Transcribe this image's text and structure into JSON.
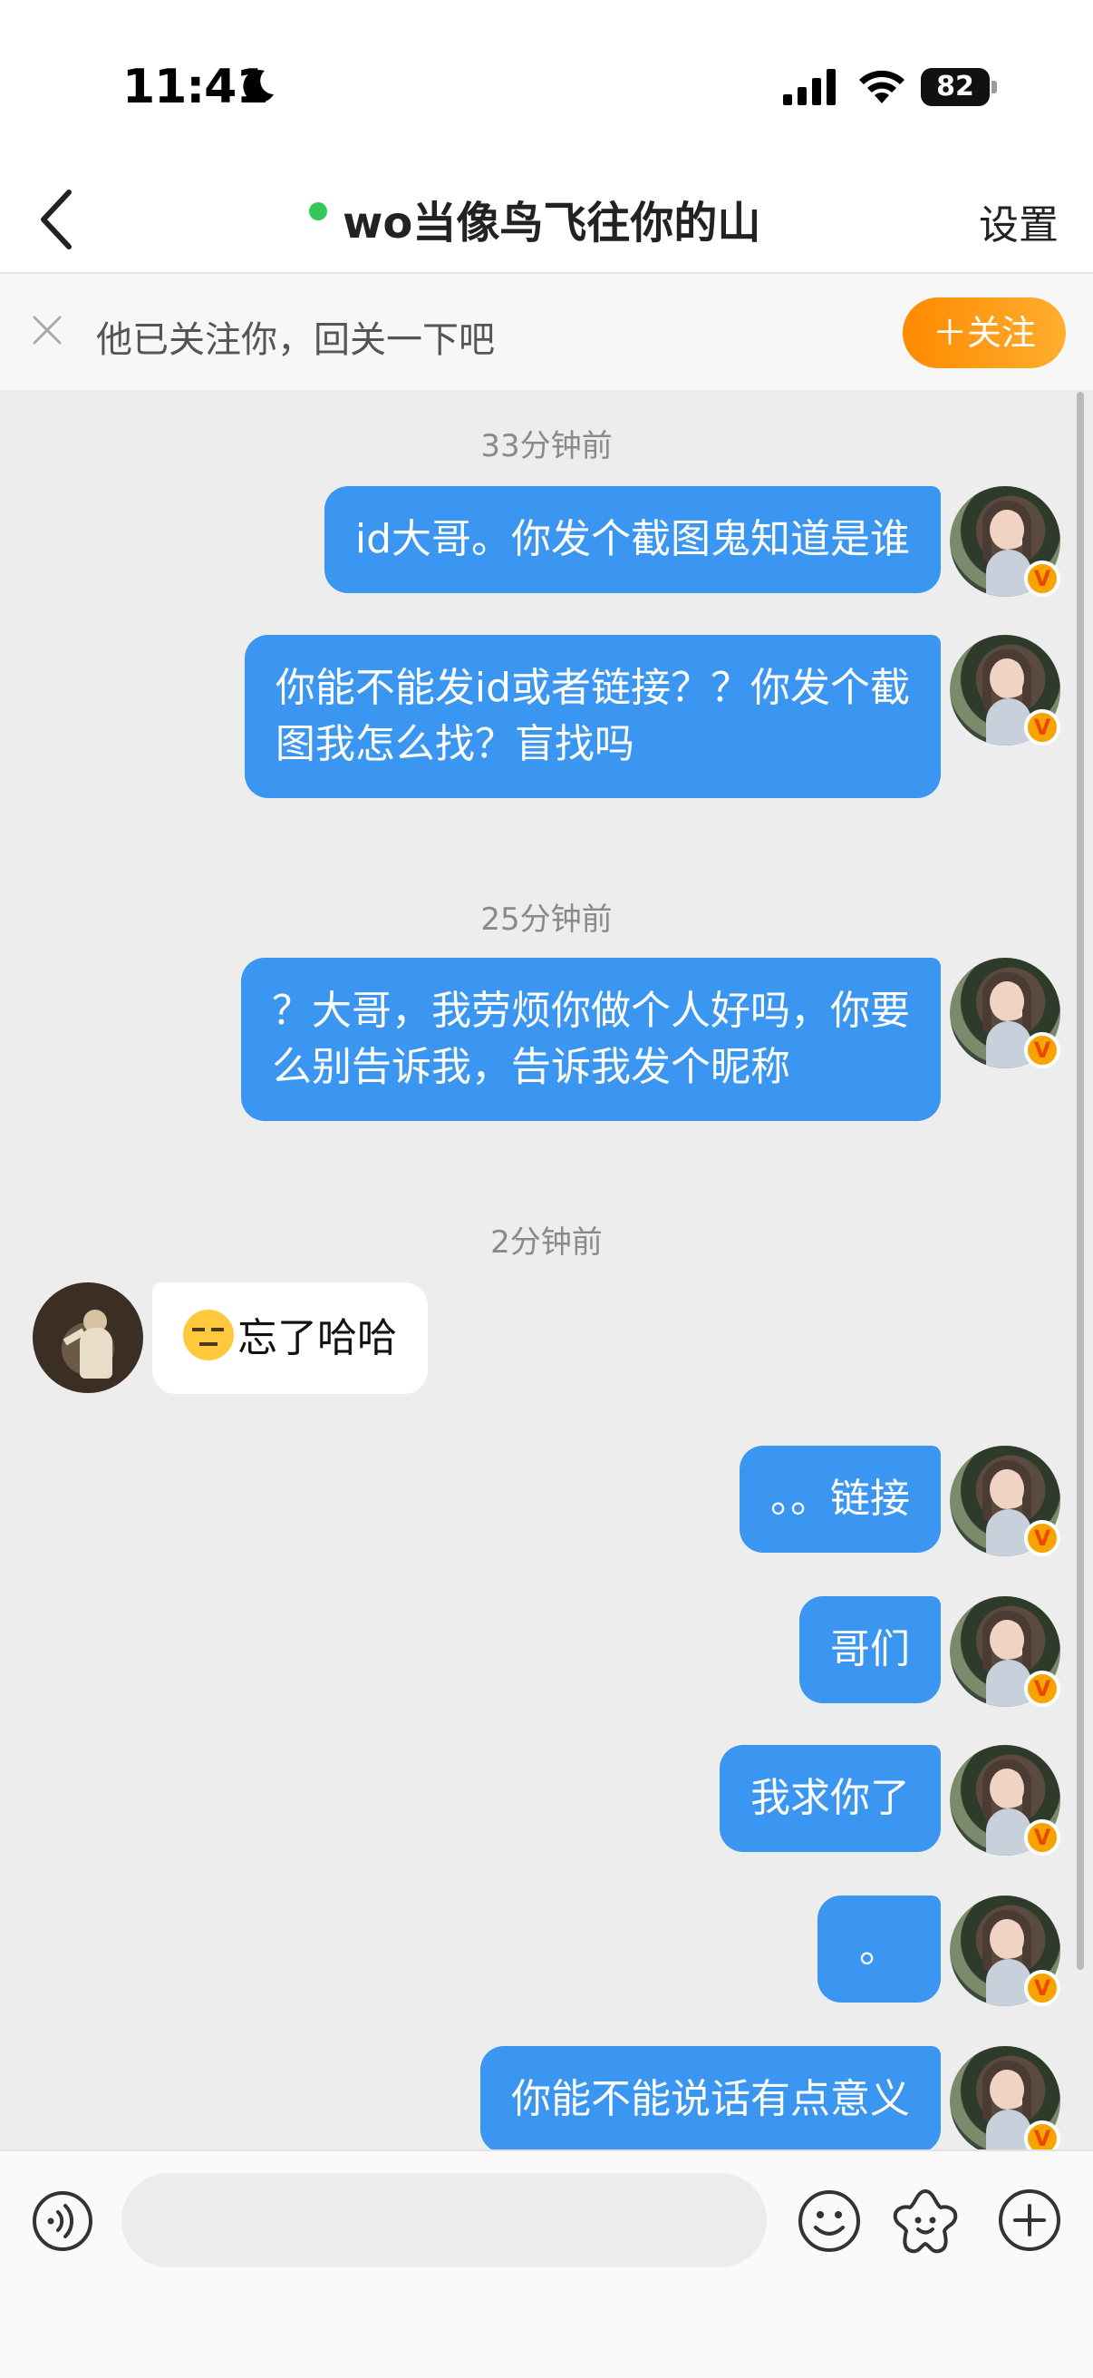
{
  "status_bar": {
    "time": "11:41",
    "battery": "82"
  },
  "header": {
    "title": "wo当像鸟飞往你的山",
    "settings": "设置"
  },
  "follow_banner": {
    "text": "他已关注你，回关一下吧",
    "button": "＋关注"
  },
  "messages": {
    "ts1": "33分钟前",
    "m1": "id大哥。你发个截图鬼知道是谁",
    "m2_line1": "你能不能发id或者链接？？你发个截",
    "m2_line2": "图我怎么找？盲找吗",
    "ts2": "25分钟前",
    "m3_line1": "？大哥，我劳烦你做个人好吗，你要",
    "m3_line2": "么别告诉我，告诉我发个昵称",
    "ts3": "2分钟前",
    "m4": "忘了哈哈",
    "m5": "。。链接",
    "m6": "哥们",
    "m7": "我求你了",
    "m8": "。",
    "m9": "你能不能说话有点意义"
  },
  "badge": "V",
  "input": {
    "placeholder": ""
  },
  "colors": {
    "outgoing_bubble": "#3a96f0",
    "follow_button": "#ff8a00",
    "online": "#35c759"
  },
  "icons": [
    "back-icon",
    "moon-icon",
    "signal-icon",
    "wifi-icon",
    "battery-icon",
    "close-icon",
    "voice-icon",
    "emoji-icon",
    "sticker-icon",
    "plus-icon"
  ]
}
